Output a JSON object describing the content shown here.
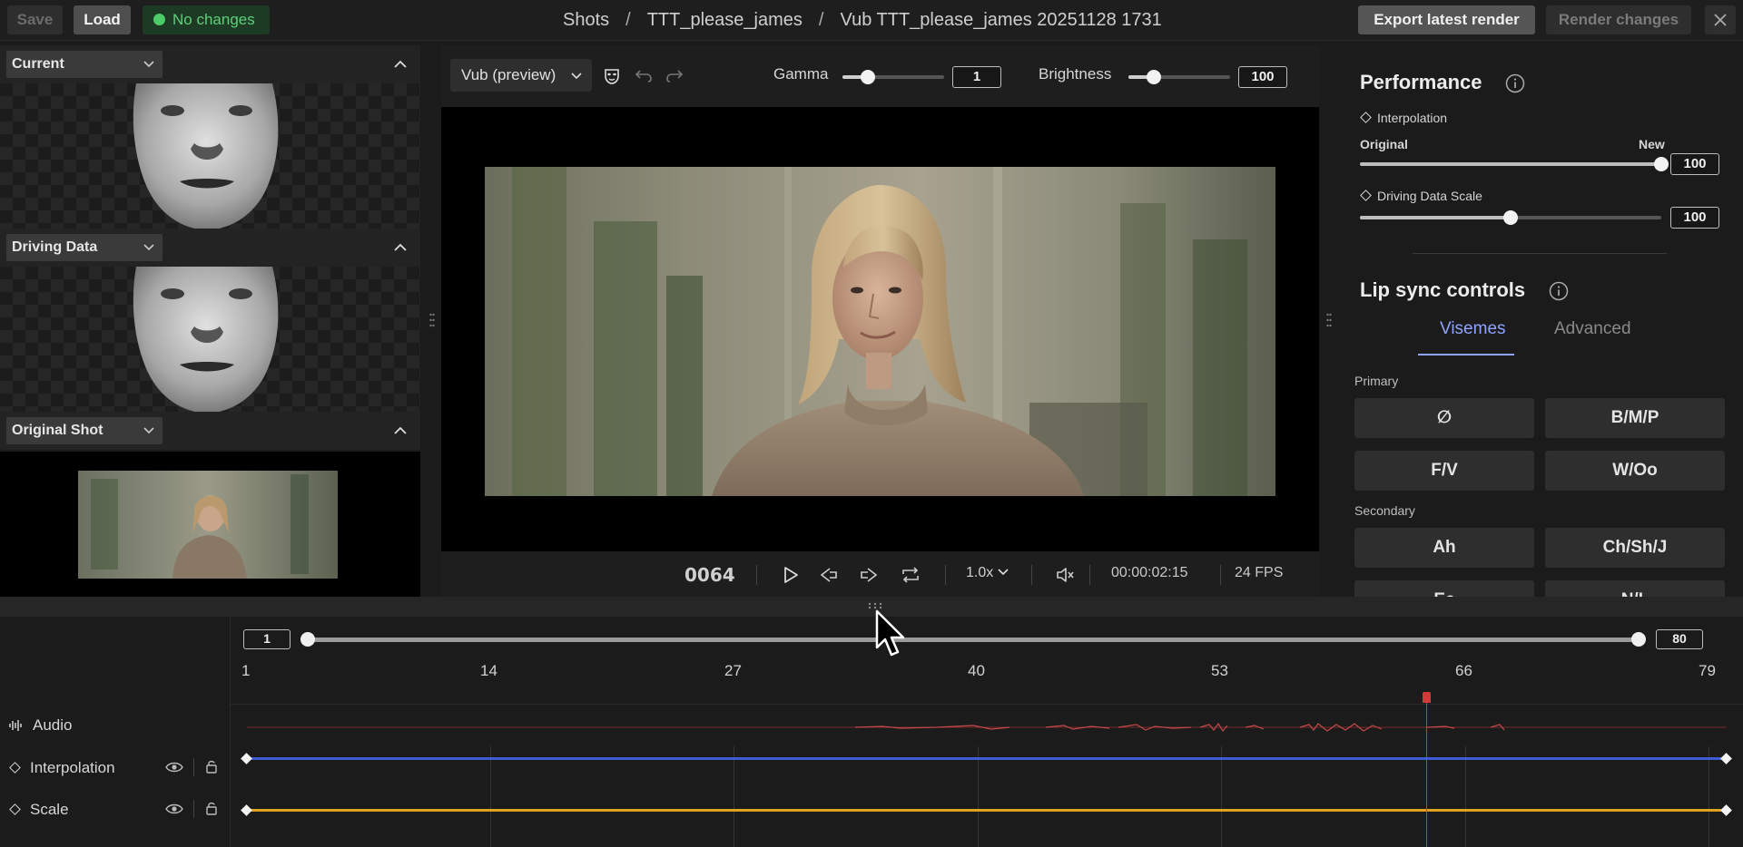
{
  "topbar": {
    "save_label": "Save",
    "load_label": "Load",
    "status_label": "No changes",
    "status_color": "#4ccd68",
    "breadcrumb": [
      "Shots",
      "TTT_please_james",
      "Vub TTT_please_james 20251128 1731"
    ],
    "export_label": "Export latest render",
    "render_label": "Render changes",
    "close_icon": "close-icon"
  },
  "left_panel": {
    "panes": [
      {
        "label": "Current"
      },
      {
        "label": "Driving Data"
      },
      {
        "label": "Original Shot"
      }
    ]
  },
  "viewer": {
    "model_select": "Vub (preview)",
    "gamma": {
      "label": "Gamma",
      "value": "1",
      "level": 0.25
    },
    "brightness": {
      "label": "Brightness",
      "value": "100",
      "level": 0.25
    },
    "frame": "0064",
    "speed": "1.0x",
    "timecode": "00:00:02:15",
    "fps": "24 FPS"
  },
  "right_panel": {
    "performance_title": "Performance",
    "interpolation_label": "Interpolation",
    "original_label": "Original",
    "new_label": "New",
    "interpolation_value": "100",
    "interpolation_level": 1.0,
    "driving_scale_label": "Driving Data Scale",
    "driving_scale_value": "100",
    "driving_scale_level": 0.5,
    "lipsync_title": "Lip sync controls",
    "tabs": [
      "Visemes",
      "Advanced"
    ],
    "primary_label": "Primary",
    "primary_buttons": [
      "∅",
      "B/M/P",
      "F/V",
      "W/Oo"
    ],
    "secondary_label": "Secondary",
    "secondary_buttons": [
      "Ah",
      "Ch/Sh/J",
      "Ee",
      "N/L"
    ]
  },
  "timeline": {
    "range_start": "1",
    "range_end": "80",
    "ruler": [
      "1",
      "14",
      "27",
      "40",
      "53",
      "66",
      "79"
    ],
    "playhead_frame": 64,
    "tracks": [
      {
        "name": "Audio",
        "color": "#c03a3a"
      },
      {
        "name": "Interpolation",
        "color": "#3e5bd6"
      },
      {
        "name": "Scale",
        "color": "#e0a020"
      }
    ]
  }
}
